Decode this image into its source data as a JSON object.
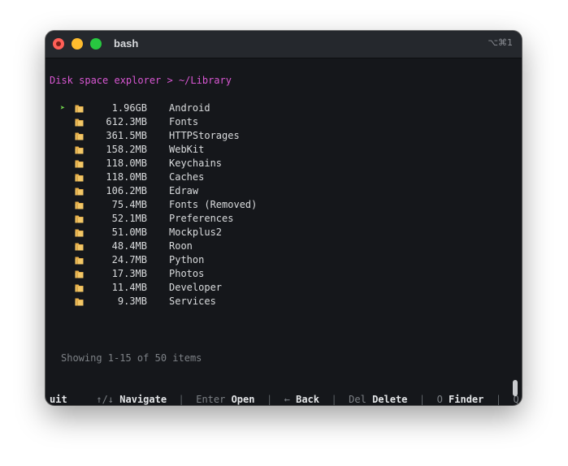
{
  "window": {
    "title": "bash",
    "shortcut": "⌥⌘1"
  },
  "terminal": {
    "header": "Disk space explorer > ~/Library",
    "cursor_glyph": "➤",
    "selected_index": 0,
    "items": [
      {
        "size": "1.96GB",
        "name": "Android"
      },
      {
        "size": "612.3MB",
        "name": "Fonts"
      },
      {
        "size": "361.5MB",
        "name": "HTTPStorages"
      },
      {
        "size": "158.2MB",
        "name": "WebKit"
      },
      {
        "size": "118.0MB",
        "name": "Keychains"
      },
      {
        "size": "118.0MB",
        "name": "Caches"
      },
      {
        "size": "106.2MB",
        "name": "Edraw"
      },
      {
        "size": "75.4MB",
        "name": "Fonts (Removed)"
      },
      {
        "size": "52.1MB",
        "name": "Preferences"
      },
      {
        "size": "51.0MB",
        "name": "Mockplus2"
      },
      {
        "size": "48.4MB",
        "name": "Roon"
      },
      {
        "size": "24.7MB",
        "name": "Python"
      },
      {
        "size": "17.3MB",
        "name": "Photos"
      },
      {
        "size": "11.4MB",
        "name": "Developer"
      },
      {
        "size": "9.3MB",
        "name": "Services"
      }
    ],
    "status": "Showing 1-15 of 50 items",
    "help": {
      "navigate_key": "↑/↓",
      "navigate_label": "Navigate",
      "open_key": "Enter",
      "open_label": "Open",
      "back_key": "←",
      "back_label": "Back",
      "delete_key": "Del",
      "delete_label": "Delete",
      "finder_key": "O",
      "finder_label": "Finder",
      "quit_key": "Q/ESC",
      "quit_label_1": "Q",
      "quit_label_2": "uit",
      "separator": "|"
    }
  },
  "colors": {
    "header": "#d957d3",
    "cursor": "#71d54c",
    "folder": "#e8b04a",
    "background": "#15171b"
  }
}
